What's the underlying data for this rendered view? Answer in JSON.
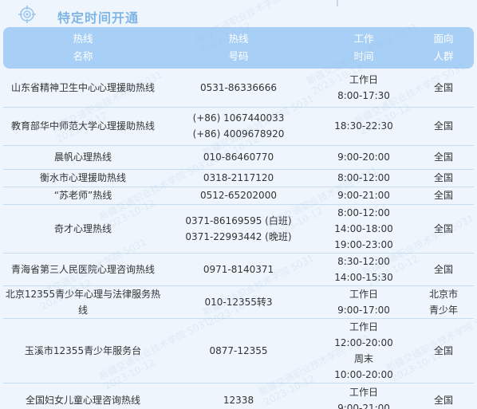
{
  "page": {
    "title": "特定时间开通",
    "icon": "target-icon"
  },
  "table": {
    "headers": [
      {
        "line1": "热线",
        "line2": "名称"
      },
      {
        "line1": "热线",
        "line2": "号码"
      },
      {
        "line1": "工作",
        "line2": "时间"
      },
      {
        "line1": "面向",
        "line2": "人群"
      }
    ],
    "rows": [
      {
        "name": [
          "山东省精神卫生中心心理援助热线"
        ],
        "numbers": [
          "0531-86336666"
        ],
        "times": [
          "工作日",
          "8:00-17:30"
        ],
        "audience": [
          "全国"
        ]
      },
      {
        "name": [
          "教育部华中师范大学心理援助热线"
        ],
        "numbers": [
          "(+86) 1067440033",
          "(+86) 4009678920"
        ],
        "times": [
          "18:30-22:30"
        ],
        "audience": [
          "全国"
        ]
      },
      {
        "name": [
          "晨帆心理热线"
        ],
        "numbers": [
          "010-86460770"
        ],
        "times": [
          "9:00-20:00"
        ],
        "audience": [
          "全国"
        ]
      },
      {
        "name": [
          "衡水市心理援助热线"
        ],
        "numbers": [
          "0318-2117120"
        ],
        "times": [
          "8:00-12:00"
        ],
        "audience": [
          "全国"
        ]
      },
      {
        "name": [
          "“苏老师”热线"
        ],
        "numbers": [
          "0512-65202000"
        ],
        "times": [
          "9:00-21:00"
        ],
        "audience": [
          "全国"
        ]
      },
      {
        "name": [
          "奇才心理热线"
        ],
        "numbers": [
          "0371-86169595 (白班)",
          "0371-22993442 (晚班)"
        ],
        "times": [
          "8:00-12:00",
          "14:00-18:00",
          "19:00-23:00"
        ],
        "audience": [
          "全国"
        ]
      },
      {
        "name": [
          "青海省第三人民医院心理咨询热线"
        ],
        "numbers": [
          "0971-8140371"
        ],
        "times": [
          "8:30-12:00",
          "14:00-15:30"
        ],
        "audience": [
          "全国"
        ]
      },
      {
        "name": [
          "北京12355青少年心理与法律服务热",
          "线"
        ],
        "numbers": [
          "010-12355转3"
        ],
        "times": [
          "工作日",
          "9:00-17:00"
        ],
        "audience": [
          "北京市",
          "青少年"
        ]
      },
      {
        "name": [
          "玉溪市12355青少年服务台"
        ],
        "numbers": [
          "0877-12355"
        ],
        "times": [
          "工作日",
          "12:00-20:00",
          "周末",
          "10:00-20:00"
        ],
        "audience": [
          "全国"
        ]
      },
      {
        "name": [
          "全国妇女儿童心理咨询热线"
        ],
        "numbers": [
          "12338"
        ],
        "times": [
          "工作日",
          "9:00-21:00"
        ],
        "audience": [
          "全国"
        ]
      }
    ]
  },
  "watermark": {
    "line1": "新疆交通职业技术学院 5031",
    "line2": "2023-10-12"
  },
  "colors": {
    "title": "#7fb6e6",
    "header_bg": "#a8d0f6",
    "page_bg": "#eef5fc",
    "row_border": "#c6dcf2"
  }
}
